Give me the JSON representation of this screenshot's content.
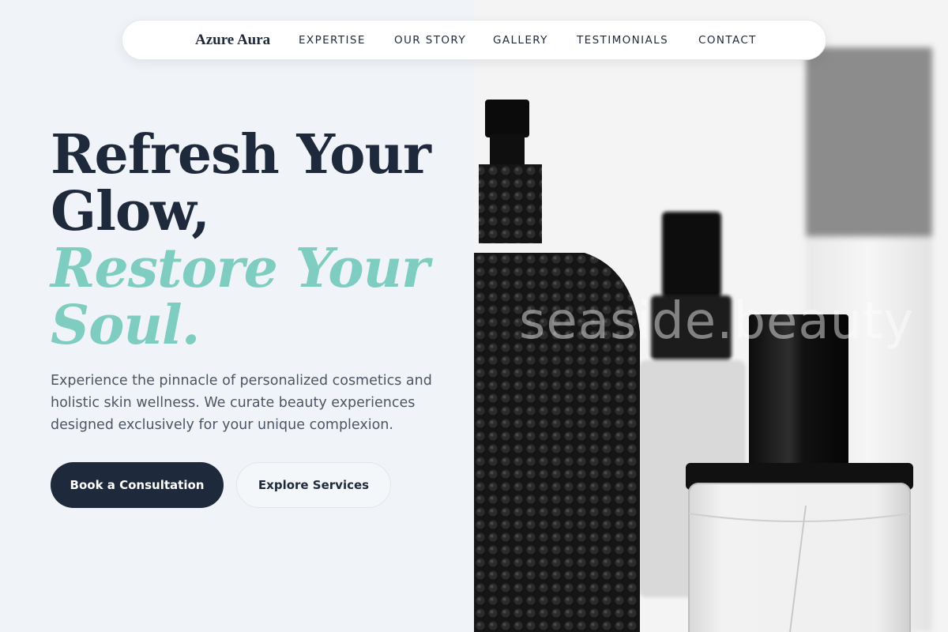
{
  "nav": {
    "brand": "Azure Aura",
    "links": [
      "EXPERTISE",
      "OUR STORY",
      "GALLERY",
      "TESTIMONIALS",
      "CONTACT"
    ]
  },
  "hero": {
    "line1": "Refresh Your",
    "line2": "Glow,",
    "line3": "Restore Your",
    "line4": "Soul.",
    "description_1": "Experience the pinnacle of personalized cosmetics and",
    "description_2": "holistic skin wellness. We curate beauty experiences",
    "description_3": "designed exclusively for your unique complexion.",
    "primary_button": "Book a Consultation",
    "secondary_button": "Explore Services"
  },
  "image": {
    "watermark": "seaside.beauty",
    "subject": "perfume-bottles-photo"
  },
  "colors": {
    "navy": "#1e2a3b",
    "accent": "#7ecdc0",
    "background": "#f0f4f8"
  }
}
